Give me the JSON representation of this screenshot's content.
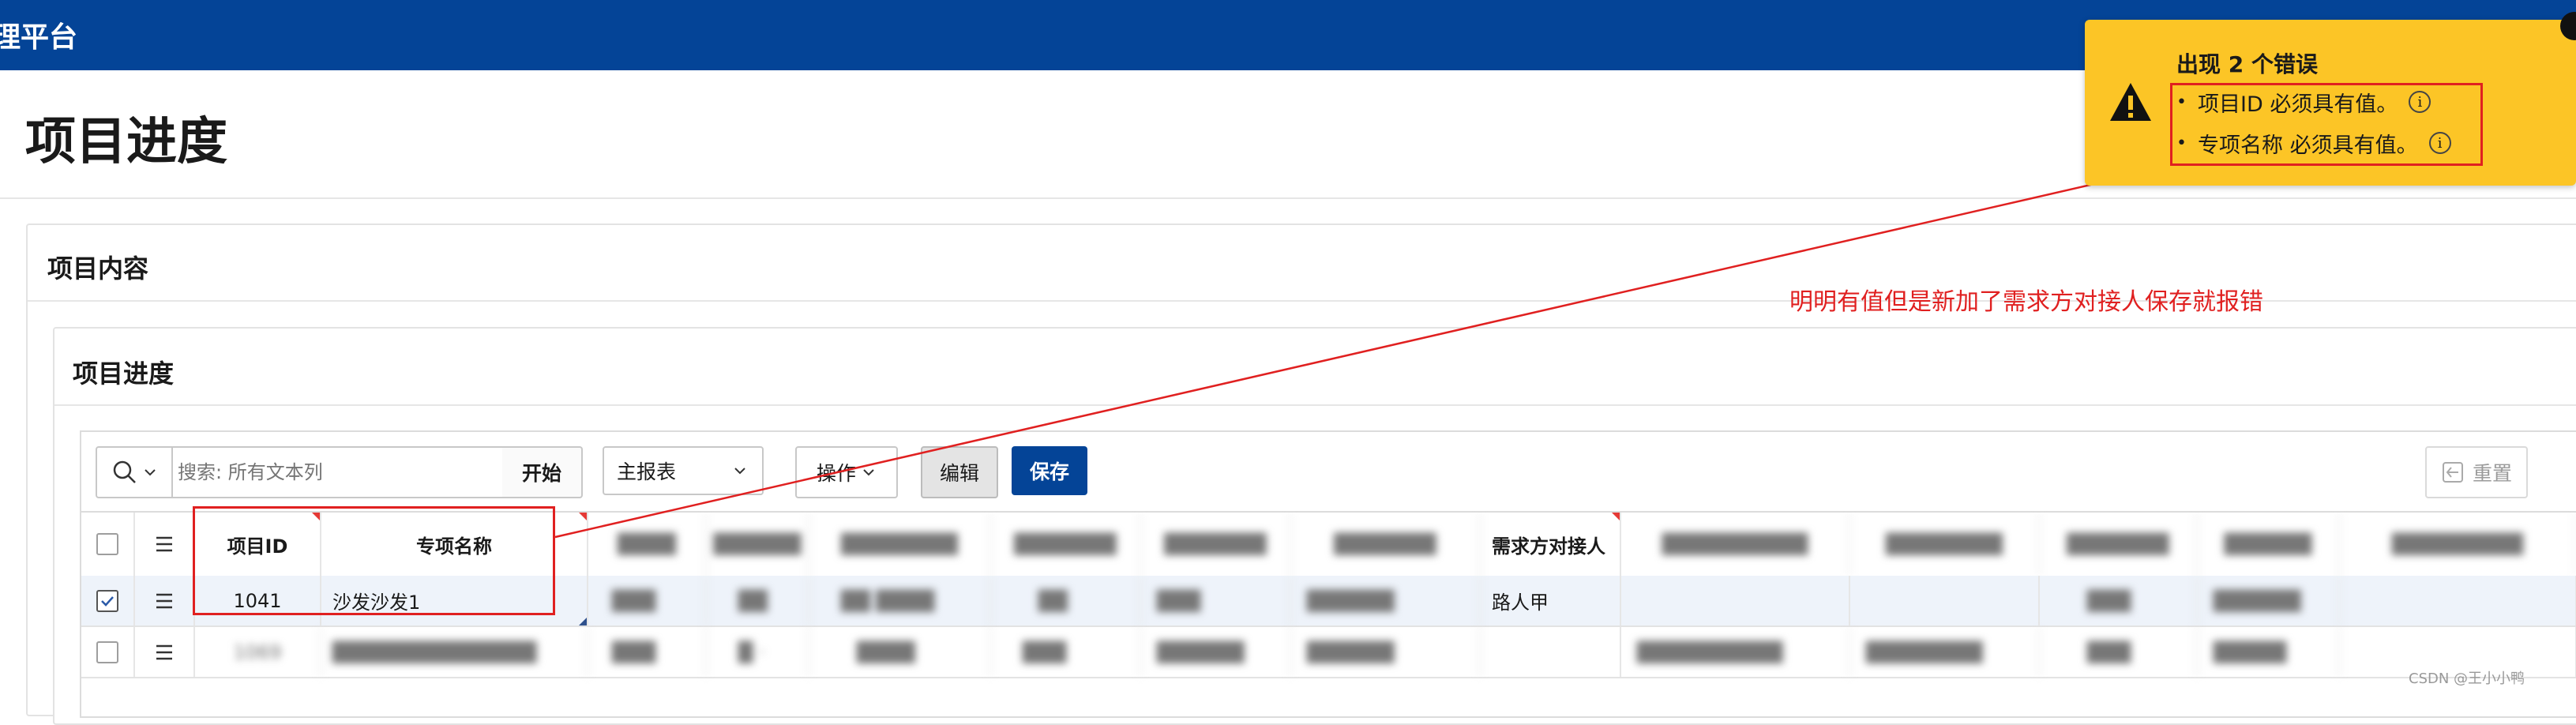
{
  "app": {
    "title": "理平台"
  },
  "page": {
    "title": "项目进度"
  },
  "region_outer": {
    "title": "项目内容"
  },
  "region_inner": {
    "title": "项目进度"
  },
  "toolbar": {
    "search_placeholder": "搜索: 所有文本列",
    "go_label": "开始",
    "report_select": "主报表",
    "actions_label": "操作",
    "edit_label": "编辑",
    "save_label": "保存",
    "reset_label": "重置"
  },
  "grid": {
    "headers": [
      "项目ID",
      "专项名称",
      "需求方对接人"
    ],
    "rows": [
      {
        "selected": true,
        "id": "1041",
        "name": "沙发沙发1",
        "contact": "路人甲"
      },
      {
        "selected": false,
        "id": "1069",
        "name": "",
        "contact": ""
      }
    ]
  },
  "annotation": {
    "text": "明明有值但是新加了需求方对接人保存就报错"
  },
  "error_toast": {
    "title": "出现 2 个错误",
    "items": [
      "项目ID 必须具有值。",
      "专项名称 必须具有值。"
    ],
    "colors": {
      "background": "#fcc526",
      "highlight": "#e02020"
    }
  },
  "colors": {
    "brand": "#044497",
    "annotation": "#e02020"
  },
  "watermark": "CSDN @王小小鸭"
}
